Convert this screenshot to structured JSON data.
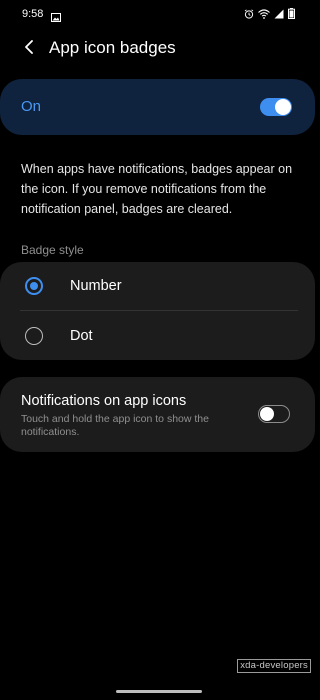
{
  "status_bar": {
    "time": "9:58",
    "left_icons": [
      "photo-icon"
    ],
    "right_icons": [
      "alarm-icon",
      "wifi-icon",
      "signal-icon",
      "battery-icon"
    ]
  },
  "header": {
    "back_icon": "chevron-left-icon",
    "title": "App icon badges"
  },
  "master_switch": {
    "label": "On",
    "checked": true
  },
  "description": "When apps have notifications, badges appear on the icon. If you remove notifications from the notification panel, badges are cleared.",
  "badge_style": {
    "section_label": "Badge style",
    "options": [
      {
        "label": "Number",
        "selected": true
      },
      {
        "label": "Dot",
        "selected": false
      }
    ]
  },
  "notifications_on_icons": {
    "title": "Notifications on app icons",
    "subtitle": "Touch and hold the app icon to show the notifications.",
    "checked": false
  },
  "watermark": "xda-developers",
  "colors": {
    "accent": "#3e8ef0",
    "on_label": "#4a97f3",
    "master_card_bg": "#0f233e",
    "card_bg": "#1c1c1c",
    "background": "#000000"
  }
}
